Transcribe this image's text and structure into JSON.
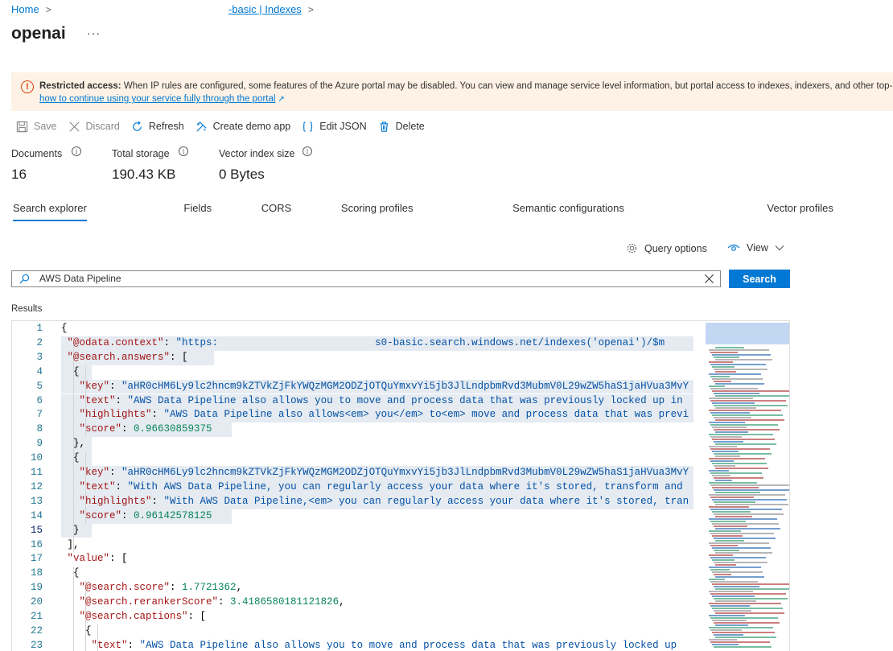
{
  "breadcrumb": {
    "home": "Home",
    "service": "-basic | Indexes"
  },
  "page": {
    "title": "openai",
    "more": "···"
  },
  "banner": {
    "bold": "Restricted access:",
    "text": " When IP rules are configured, some features of the Azure portal may be disabled. You can view and manage service level information, but portal access to indexes, indexers, and other top-level re",
    "link": "how to continue using your service fully through the portal"
  },
  "toolbar": {
    "save": "Save",
    "discard": "Discard",
    "refresh": "Refresh",
    "create_demo": "Create demo app",
    "edit_json": "Edit JSON",
    "delete": "Delete"
  },
  "stats": [
    {
      "label": "Documents",
      "value": "16"
    },
    {
      "label": "Total storage",
      "value": "190.43 KB"
    },
    {
      "label": "Vector index size",
      "value": "0 Bytes"
    }
  ],
  "tabs": [
    "Search explorer",
    "Fields",
    "CORS",
    "Scoring profiles",
    "Semantic configurations",
    "Vector profiles"
  ],
  "query_options": "Query options",
  "view": "View",
  "search": {
    "value": "AWS Data Pipeline",
    "button": "Search"
  },
  "results_label": "Results",
  "editor": {
    "line_numbers": [
      "1",
      "2",
      "3",
      "4",
      "5",
      "6",
      "7",
      "8",
      "9",
      "10",
      "11",
      "12",
      "13",
      "14",
      "15",
      "16",
      "17",
      "18",
      "19",
      "20",
      "21",
      "22",
      "23"
    ],
    "lines": [
      "{",
      "\"@odata.context\": \"https:                          s0-basic.search.windows.net/indexes('openai')/$m",
      "\"@search.answers\": [",
      "{",
      "\"key\": \"aHR0cHM6Ly9lc2hncm9kZTVkZjFkYWQzMGM2ODZjOTQuYmxvYi5jb3JlLndpbmRvd3MubmV0L29wZW5haS1jaHVua3MvY",
      "\"text\": \"AWS Data Pipeline also allows you to move and process data that was previously locked up in",
      "\"highlights\": \"AWS Data Pipeline also allows<em> you</em> to<em> move and process data that was previ",
      "\"score\": 0.96630859375",
      "},",
      "{",
      "\"key\": \"aHR0cHM6Ly9lc2hncm9kZTVkZjFkYWQzMGM2ODZjOTQuYmxvYi5jb3JlLndpbmRvd3MubmV0L29wZW5haS1jaHVua3MvY",
      "\"text\": \"With AWS Data Pipeline, you can regularly access your data where it's stored, transform and",
      "\"highlights\": \"With AWS Data Pipeline,<em> you can regularly access your data where it's stored, tran",
      "\"score\": 0.96142578125",
      "}",
      "],",
      "\"value\": [",
      "{",
      "\"@search.score\": 1.7721362,",
      "\"@search.rerankerScore\": 3.4186580181121826,",
      "\"@search.captions\": [",
      "{",
      "\"text\": \"AWS Data Pipeline also allows you to move and process data that was previously locked up"
    ]
  }
}
